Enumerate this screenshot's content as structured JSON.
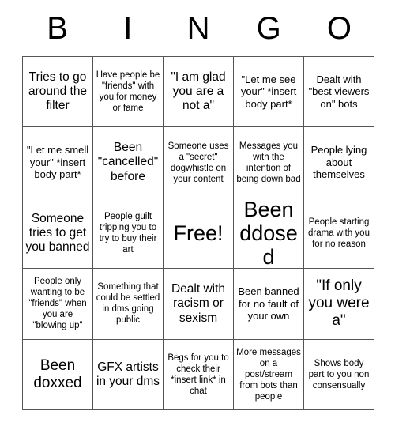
{
  "card": {
    "title": "BINGO",
    "header_letters": [
      "B",
      "I",
      "N",
      "G",
      "O"
    ],
    "free_space_label": "Free!",
    "rows": 5,
    "columns": 5,
    "border_color": "#555555",
    "text_color": "#000000",
    "background_color": "#ffffff",
    "cells": [
      {
        "text": "Tries to go around the filter",
        "size": "md",
        "free": false
      },
      {
        "text": "Have people be \"friends\" with you for money or fame",
        "size": "xs",
        "free": false
      },
      {
        "text": "\"I am glad you are a not a\"",
        "size": "md",
        "free": false
      },
      {
        "text": "\"Let me see your\" *insert body part*",
        "size": "sm",
        "free": false
      },
      {
        "text": "Dealt with \"best viewers on\" bots",
        "size": "sm",
        "free": false
      },
      {
        "text": "\"Let me smell your\" *insert body part*",
        "size": "sm",
        "free": false
      },
      {
        "text": "Been \"cancelled\" before",
        "size": "md",
        "free": false
      },
      {
        "text": "Someone uses a \"secret\" dogwhistle on your content",
        "size": "xs",
        "free": false
      },
      {
        "text": "Messages you with the intention of being down bad",
        "size": "xs",
        "free": false
      },
      {
        "text": "People lying about themselves",
        "size": "sm",
        "free": false
      },
      {
        "text": "Someone tries to get you banned",
        "size": "md",
        "free": false
      },
      {
        "text": "People guilt tripping you to try to buy their art",
        "size": "xs",
        "free": false
      },
      {
        "text": "Free!",
        "size": "xl",
        "free": true
      },
      {
        "text": "Been ddosed",
        "size": "xl",
        "free": false
      },
      {
        "text": "People starting drama with you for no reason",
        "size": "xs",
        "free": false
      },
      {
        "text": "People only wanting to be \"friends\" when you are \"blowing up\"",
        "size": "xs",
        "free": false
      },
      {
        "text": "Something that could be settled in dms going public",
        "size": "xs",
        "free": false
      },
      {
        "text": "Dealt with racism or sexism",
        "size": "md",
        "free": false
      },
      {
        "text": "Been banned for no fault of your own",
        "size": "sm",
        "free": false
      },
      {
        "text": "\"If only you were a\"",
        "size": "lg",
        "free": false
      },
      {
        "text": "Been doxxed",
        "size": "lg",
        "free": false
      },
      {
        "text": "GFX artists in your dms",
        "size": "md",
        "free": false
      },
      {
        "text": "Begs for you to check their *insert link* in chat",
        "size": "xs",
        "free": false
      },
      {
        "text": "More messages on a post/stream from bots than people",
        "size": "xs",
        "free": false
      },
      {
        "text": "Shows body part to you non consensually",
        "size": "xs",
        "free": false
      }
    ]
  }
}
